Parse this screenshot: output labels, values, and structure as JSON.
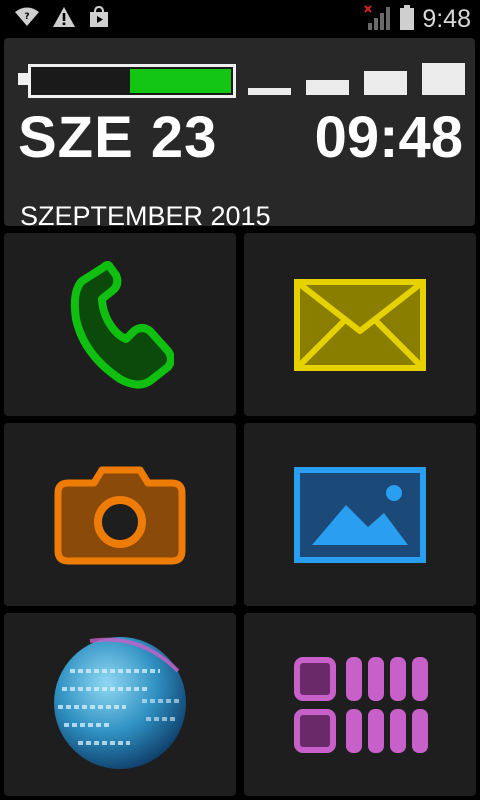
{
  "status_bar": {
    "time": "9:48",
    "icons": [
      "wifi-question-icon",
      "warning-icon",
      "store-bag-icon",
      "no-signal-icon",
      "battery-icon"
    ]
  },
  "header": {
    "day_label": "SZE 23",
    "clock": "09:48",
    "full_date": "SZEPTEMBER 2015",
    "battery_level_percent": 50,
    "signal_bars": 4
  },
  "tiles": [
    {
      "name": "phone",
      "icon": "phone-icon",
      "color": "#10c010"
    },
    {
      "name": "messages",
      "icon": "envelope-icon",
      "color": "#e6d200"
    },
    {
      "name": "camera",
      "icon": "camera-icon",
      "color": "#f07c08"
    },
    {
      "name": "gallery",
      "icon": "picture-icon",
      "color": "#2a9ef0"
    },
    {
      "name": "browser",
      "icon": "globe-icon",
      "color": "#2e8fc0"
    },
    {
      "name": "apps",
      "icon": "app-grid-icon",
      "color": "#c760c9"
    }
  ],
  "colors": {
    "background": "#000000",
    "panel": "#282828",
    "tile": "#1e1e1e",
    "battery_green": "#13c613",
    "text": "#ffffff"
  }
}
